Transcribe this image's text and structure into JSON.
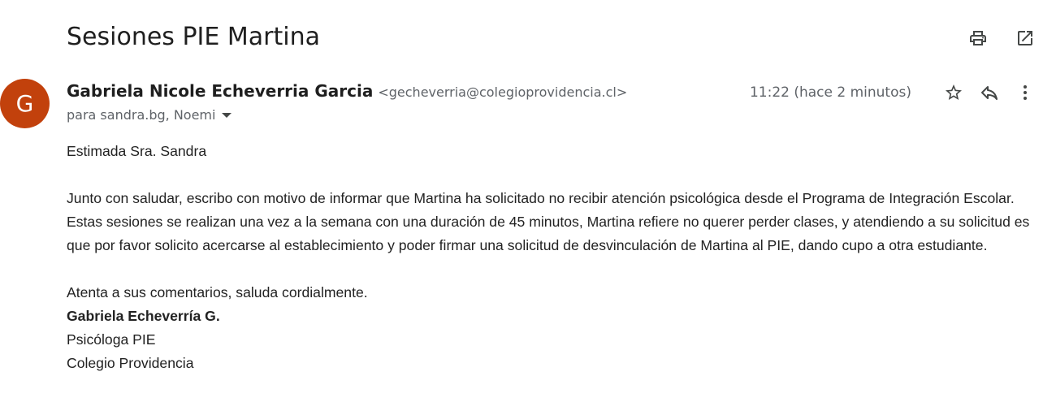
{
  "email": {
    "subject": "Sesiones PIE Martina",
    "sender": {
      "avatar_letter": "G",
      "avatar_color": "#c2410c",
      "name": "Gabriela Nicole Echeverria Garcia",
      "email": "<gecheverria@colegioprovidencia.cl>"
    },
    "recipients": "para sandra.bg, Noemi",
    "time": "11:22 (hace 2 minutos)",
    "body": {
      "greeting": "Estimada Sra. Sandra",
      "paragraph": "Junto con saludar, escribo con motivo de informar que Martina ha solicitado no recibir atención psicológica desde el Programa de Integración Escolar. Estas sesiones se realizan una vez a la semana con una duración de 45 minutos, Martina refiere no querer perder clases, y atendiendo a su solicitud es que por favor solicito acercarse al establecimiento y poder firmar una solicitud de desvinculación de Martina al PIE, dando cupo a otra estudiante.",
      "closing": "Atenta a sus comentarios, saluda cordialmente.",
      "signature_name": "Gabriela Echeverría G.",
      "signature_role": "Psicóloga PIE",
      "signature_org": "Colegio Providencia"
    }
  },
  "icons": {
    "print": "print-icon",
    "open_new_window": "open-in-new-window-icon",
    "star": "star-icon",
    "reply": "reply-icon",
    "more": "more-vertical-icon"
  }
}
